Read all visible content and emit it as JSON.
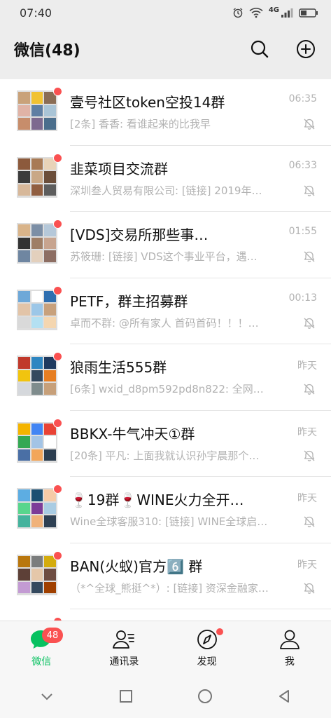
{
  "status_bar": {
    "time": "07:40",
    "network": "4G"
  },
  "header": {
    "title": "微信(48)"
  },
  "chats": [
    {
      "name": "壹号社区token空投14群",
      "preview": "[2条] 香香: 看谁起来的比我早",
      "time": "06:35",
      "muted": true,
      "unread_dot": true,
      "avatar_colors": [
        "#c9a27a",
        "#f1c232",
        "#8a6d55",
        "#e0b3a6",
        "#5f7fa3",
        "#a9c4d6",
        "#c78d6b",
        "#7d6a8f",
        "#4b6e8c"
      ]
    },
    {
      "name": "韭菜项目交流群",
      "preview": "深圳叁人贸易有限公司: [链接] 2019年…",
      "time": "06:33",
      "muted": true,
      "unread_dot": true,
      "avatar_colors": [
        "#8c5a3c",
        "#a87a55",
        "#e8d3b8",
        "#3b3b3b",
        "#c9a886",
        "#6b4e3a",
        "#d7b89a",
        "#915f41",
        "#5d5d5d"
      ]
    },
    {
      "name": "[VDS]交易所那些事…",
      "preview": "苏筱珊: [链接] VDS这个事业平台，遇…",
      "time": "01:55",
      "muted": true,
      "unread_dot": true,
      "avatar_colors": [
        "#d9b48a",
        "#7c8fa6",
        "#b5c8d9",
        "#333333",
        "#9e7e66",
        "#c7a48f",
        "#6f86a1",
        "#e3d0bd",
        "#8d6e63"
      ]
    },
    {
      "name": "PETF，群主招募群",
      "preview": "卓而不群: @所有家人 首码首码！！！…",
      "time": "00:13",
      "muted": true,
      "unread_dot": true,
      "avatar_colors": [
        "#6ea8d8",
        "#ffffff",
        "#2f6fb0",
        "#e2c4a8",
        "#9cc7e8",
        "#c8a17c",
        "#d9d9d9",
        "#b3e0f2",
        "#f4d6b0"
      ]
    },
    {
      "name": "狼雨生活555群",
      "preview": "[6条] wxid_d8pm592pd8n822: 全网首…",
      "time": "昨天",
      "muted": true,
      "unread_dot": true,
      "avatar_colors": [
        "#c0392b",
        "#2e86c1",
        "#1f3a5f",
        "#f1c40f",
        "#34495e",
        "#e67e22",
        "#d5d8dc",
        "#7f8c8d",
        "#c7a07a"
      ]
    },
    {
      "name": "BBKX-牛气冲天①群",
      "preview": "[20条] 平凡: 上面我就认识孙宇晨那个…",
      "time": "昨天",
      "muted": true,
      "unread_dot": true,
      "avatar_colors": [
        "#f4b400",
        "#4285f4",
        "#e94335",
        "#34a853",
        "#a3c4e6",
        "#ffffff",
        "#4a6fa5",
        "#f2a65a",
        "#2c3e50"
      ]
    },
    {
      "name": "🍷19群🍷WINE火力全开…",
      "preview": "Wine全球客服310: [链接] WINE全球启…",
      "time": "昨天",
      "muted": true,
      "unread_dot": true,
      "avatar_colors": [
        "#5dade2",
        "#1b4f72",
        "#f5cba7",
        "#58d68d",
        "#7d3c98",
        "#a9cce3",
        "#45b39d",
        "#f0b27a",
        "#2e4053"
      ]
    },
    {
      "name": "BAN(火蚁)官方6️⃣ 群",
      "preview": "（*^全球_熊挺^*）: [链接] 资深金融家…",
      "time": "昨天",
      "muted": true,
      "unread_dot": true,
      "avatar_colors": [
        "#b9770e",
        "#7b7d7d",
        "#d4ac0d",
        "#5d4037",
        "#e5c7a9",
        "#6d4c41",
        "#c39bd3",
        "#34495e",
        "#a04000"
      ]
    }
  ],
  "tabs": [
    {
      "label": "微信",
      "active": true,
      "badge": "48",
      "icon": "chat-icon"
    },
    {
      "label": "通讯录",
      "active": false,
      "badge": "",
      "icon": "contacts-icon"
    },
    {
      "label": "发现",
      "active": false,
      "badge": "",
      "dot": true,
      "icon": "compass-icon"
    },
    {
      "label": "我",
      "active": false,
      "badge": "",
      "icon": "person-icon"
    }
  ],
  "colors": {
    "accent": "#07c160",
    "badge": "#fa5151",
    "muted_text": "#b2b2b2"
  }
}
